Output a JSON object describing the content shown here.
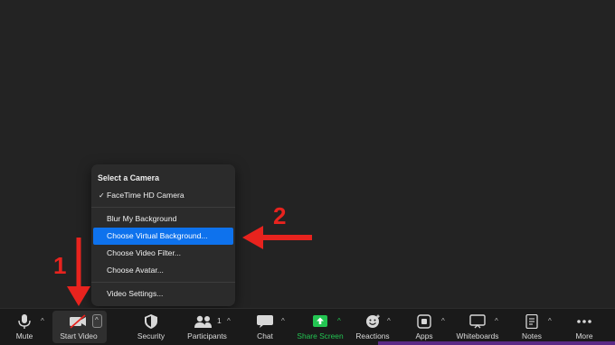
{
  "camera_menu": {
    "header": "Select a Camera",
    "items": [
      {
        "label": "FaceTime HD Camera",
        "checked": true
      },
      {
        "label": "Blur My Background"
      },
      {
        "label": "Choose Virtual Background...",
        "selected": true
      },
      {
        "label": "Choose Video Filter..."
      },
      {
        "label": "Choose Avatar..."
      },
      {
        "label": "Video Settings..."
      }
    ]
  },
  "toolbar": {
    "mute": "Mute",
    "start_video": "Start Video",
    "security": "Security",
    "participants": "Participants",
    "participants_count": "1",
    "chat": "Chat",
    "share_screen": "Share Screen",
    "reactions": "Reactions",
    "apps": "Apps",
    "whiteboards": "Whiteboards",
    "notes": "Notes",
    "more": "More",
    "caret": "^"
  },
  "annotations": {
    "step1": "1",
    "step2": "2",
    "arrow_color": "#e8231e"
  },
  "colors": {
    "background": "#232323",
    "toolbar": "#1a1a1a",
    "selection": "#0e72ed",
    "share_green": "#23c552"
  }
}
